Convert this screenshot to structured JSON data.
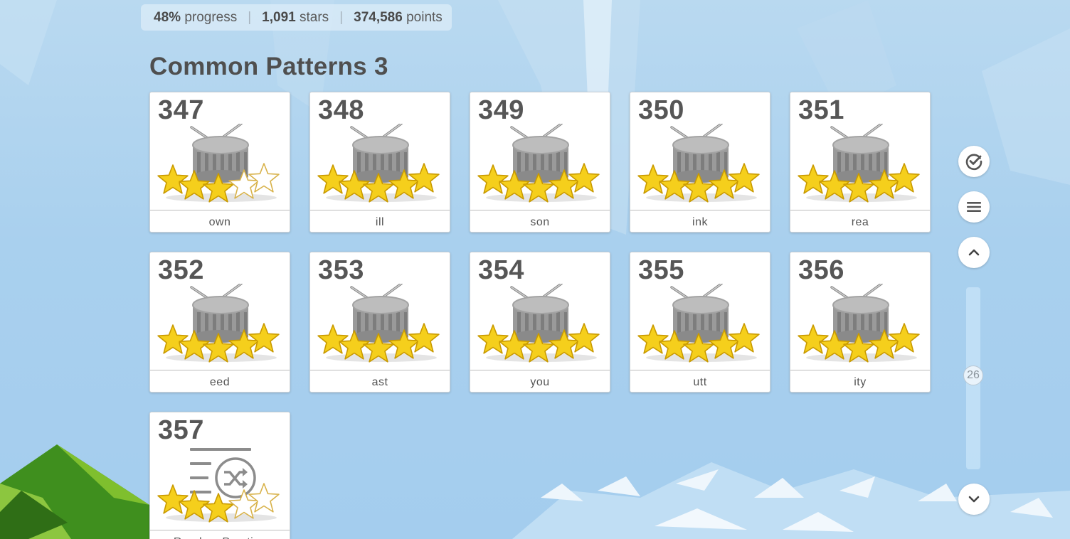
{
  "stats": {
    "progress_value": "48%",
    "progress_label": "progress",
    "stars_value": "1,091",
    "stars_label": "stars",
    "points_value": "374,586",
    "points_label": "points"
  },
  "section": {
    "title": "Common Patterns 3"
  },
  "lessons": [
    {
      "number": "347",
      "label": "own",
      "icon": "drum-icon",
      "stars": 3
    },
    {
      "number": "348",
      "label": "ill",
      "icon": "drum-icon",
      "stars": 5
    },
    {
      "number": "349",
      "label": "son",
      "icon": "drum-icon",
      "stars": 5
    },
    {
      "number": "350",
      "label": "ink",
      "icon": "drum-icon",
      "stars": 5
    },
    {
      "number": "351",
      "label": "rea",
      "icon": "drum-icon",
      "stars": 5
    },
    {
      "number": "352",
      "label": "eed",
      "icon": "drum-icon",
      "stars": 5
    },
    {
      "number": "353",
      "label": "ast",
      "icon": "drum-icon",
      "stars": 5
    },
    {
      "number": "354",
      "label": "you",
      "icon": "drum-icon",
      "stars": 5
    },
    {
      "number": "355",
      "label": "utt",
      "icon": "drum-icon",
      "stars": 5
    },
    {
      "number": "356",
      "label": "ity",
      "icon": "drum-icon",
      "stars": 5
    },
    {
      "number": "357",
      "label": "Random Practice",
      "icon": "shuffle-list-icon",
      "stars": 3
    }
  ],
  "side_controls": {
    "check_icon": "check-circle-icon",
    "menu_icon": "hamburger-menu-icon",
    "up_icon": "chevron-up-icon",
    "down_icon": "chevron-down-icon",
    "scroll_position": "26"
  },
  "colors": {
    "star_fill": "#f5cf1c",
    "star_outline": "#c99a00",
    "empty_star": "#ffffff",
    "drum_gray": "#9e9e9e",
    "text_dark": "#4f4f4f"
  }
}
